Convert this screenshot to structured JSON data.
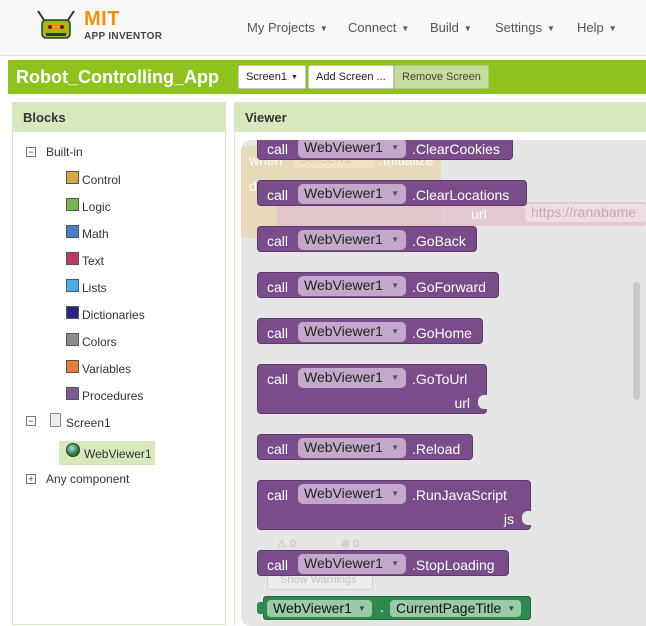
{
  "brand": {
    "mit": "MIT",
    "app_inventor": "APP INVENTOR"
  },
  "nav": [
    {
      "label": "My Projects"
    },
    {
      "label": "Connect"
    },
    {
      "label": "Build"
    },
    {
      "label": "Settings"
    },
    {
      "label": "Help"
    }
  ],
  "toolbar": {
    "project_title": "Robot_Controlling_App",
    "screen_select": "Screen1",
    "add_screen": "Add Screen ...",
    "remove_screen": "Remove Screen"
  },
  "blocks_panel": {
    "title": "Blocks",
    "builtin_label": "Built-in",
    "categories": [
      {
        "label": "Control",
        "color": "#d9a943"
      },
      {
        "label": "Logic",
        "color": "#77b553"
      },
      {
        "label": "Math",
        "color": "#4b7cc4"
      },
      {
        "label": "Text",
        "color": "#bd3a64"
      },
      {
        "label": "Lists",
        "color": "#48afe0"
      },
      {
        "label": "Dictionaries",
        "color": "#2a2486"
      },
      {
        "label": "Colors",
        "color": "#8c8c8c"
      },
      {
        "label": "Variables",
        "color": "#e57d38"
      },
      {
        "label": "Procedures",
        "color": "#7c5b98"
      }
    ],
    "screen_label": "Screen1",
    "component_label": "WebViewer1",
    "any_component_label": "Any component"
  },
  "viewer": {
    "title": "Viewer",
    "ghost": {
      "when": "when",
      "screen": "Screen1",
      "event": ".Initialize",
      "do": "do",
      "url_label": "url",
      "url_value": "https://ranabame"
    },
    "call_word": "call",
    "component": "WebViewer1",
    "methods": [
      {
        "name": ".ClearCookies",
        "arg": ""
      },
      {
        "name": ".ClearLocations",
        "arg": ""
      },
      {
        "name": ".GoBack",
        "arg": ""
      },
      {
        "name": ".GoForward",
        "arg": ""
      },
      {
        "name": ".GoHome",
        "arg": ""
      },
      {
        "name": ".GoToUrl",
        "arg": "url"
      },
      {
        "name": ".Reload",
        "arg": ""
      },
      {
        "name": ".RunJavaScript",
        "arg": "js"
      },
      {
        "name": ".StopLoading",
        "arg": ""
      }
    ],
    "getter": {
      "component": "WebViewer1",
      "dot": ".",
      "property": "CurrentPageTitle"
    },
    "warnings": {
      "warning_count": "0",
      "error_count": "0",
      "show_label": "Show Warnings"
    }
  },
  "colors": {
    "accent_green": "#8dc21f",
    "method_block": "#7a4c8a",
    "getter_block": "#2f8a4d"
  }
}
